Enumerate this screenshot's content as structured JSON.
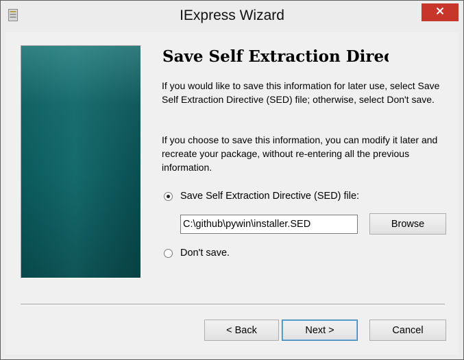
{
  "window": {
    "title": "IExpress Wizard",
    "icons": {
      "app": "app-icon",
      "close": "close-icon"
    },
    "accent_colors": {
      "close_button": "#c7352b",
      "banner": "#0b5a5c"
    }
  },
  "page": {
    "heading": "Save Self Extraction Directive",
    "paragraph1": "If you would like to save this information for later use, select Save Self Extraction Directive (SED) file; otherwise, select Don't save.",
    "paragraph2": "If you choose to save this information, you can modify it later and recreate your package, without re-entering all the previous information."
  },
  "options": {
    "save_sed": {
      "label": "Save Self Extraction Directive (SED) file:",
      "selected": true
    },
    "dont_save": {
      "label": "Don't save.",
      "selected": false
    }
  },
  "sed_path": {
    "value": "C:\\github\\pywin\\installer.SED"
  },
  "buttons": {
    "browse": "Browse",
    "back": "< Back",
    "next": "Next >",
    "cancel": "Cancel"
  }
}
